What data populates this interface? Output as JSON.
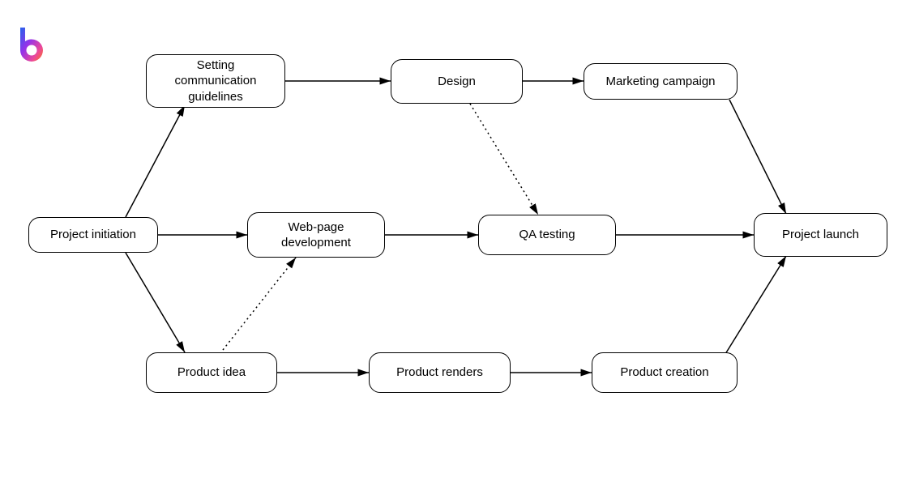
{
  "logo": {
    "name": "b-logo"
  },
  "nodes": {
    "project_initiation": {
      "label": "Project initiation"
    },
    "setting_comm": {
      "label": "Setting\ncommunication\nguidelines"
    },
    "design": {
      "label": "Design"
    },
    "marketing": {
      "label": "Marketing campaign"
    },
    "webdev": {
      "label": "Web-page\ndevelopment"
    },
    "qa": {
      "label": "QA testing"
    },
    "product_idea": {
      "label": "Product idea"
    },
    "product_renders": {
      "label": "Product renders"
    },
    "product_creation": {
      "label": "Product creation"
    },
    "project_launch": {
      "label": "Project launch"
    }
  },
  "edges": [
    {
      "from": "project_initiation",
      "to": "setting_comm",
      "style": "solid"
    },
    {
      "from": "project_initiation",
      "to": "webdev",
      "style": "solid"
    },
    {
      "from": "project_initiation",
      "to": "product_idea",
      "style": "solid"
    },
    {
      "from": "setting_comm",
      "to": "design",
      "style": "solid"
    },
    {
      "from": "design",
      "to": "marketing",
      "style": "solid"
    },
    {
      "from": "design",
      "to": "qa",
      "style": "dotted"
    },
    {
      "from": "webdev",
      "to": "qa",
      "style": "solid"
    },
    {
      "from": "product_idea",
      "to": "webdev",
      "style": "dotted"
    },
    {
      "from": "product_idea",
      "to": "product_renders",
      "style": "solid"
    },
    {
      "from": "product_renders",
      "to": "product_creation",
      "style": "solid"
    },
    {
      "from": "qa",
      "to": "project_launch",
      "style": "solid"
    },
    {
      "from": "marketing",
      "to": "project_launch",
      "style": "solid"
    },
    {
      "from": "product_creation",
      "to": "project_launch",
      "style": "solid"
    }
  ]
}
